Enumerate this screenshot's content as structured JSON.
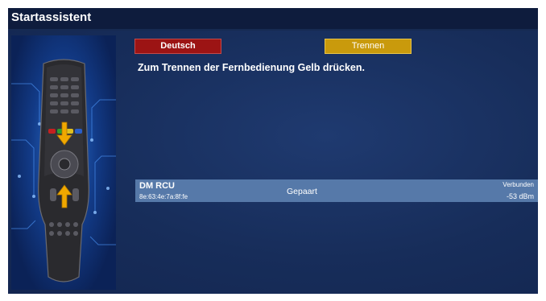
{
  "window": {
    "title": "Startassistent"
  },
  "buttons": {
    "red_label": "Deutsch",
    "yellow_label": "Trennen"
  },
  "instruction": "Zum Trennen der Fernbedienung Gelb drücken.",
  "device": {
    "name": "DM RCU",
    "mac": "8e:63:4e:7a:8f:fe",
    "state": "Gepaart",
    "connection": "Verbunden",
    "signal": "-53 dBm"
  },
  "colors": {
    "background": "#162a52",
    "titlebar": "#0e1c3d",
    "red_button": "#9c1414",
    "yellow_button": "#c99a0c",
    "device_row": "#5679a9",
    "arrow": "#f0a800"
  },
  "icons": {
    "remote": "remote-control-image",
    "arrows": "arrow-icon"
  }
}
